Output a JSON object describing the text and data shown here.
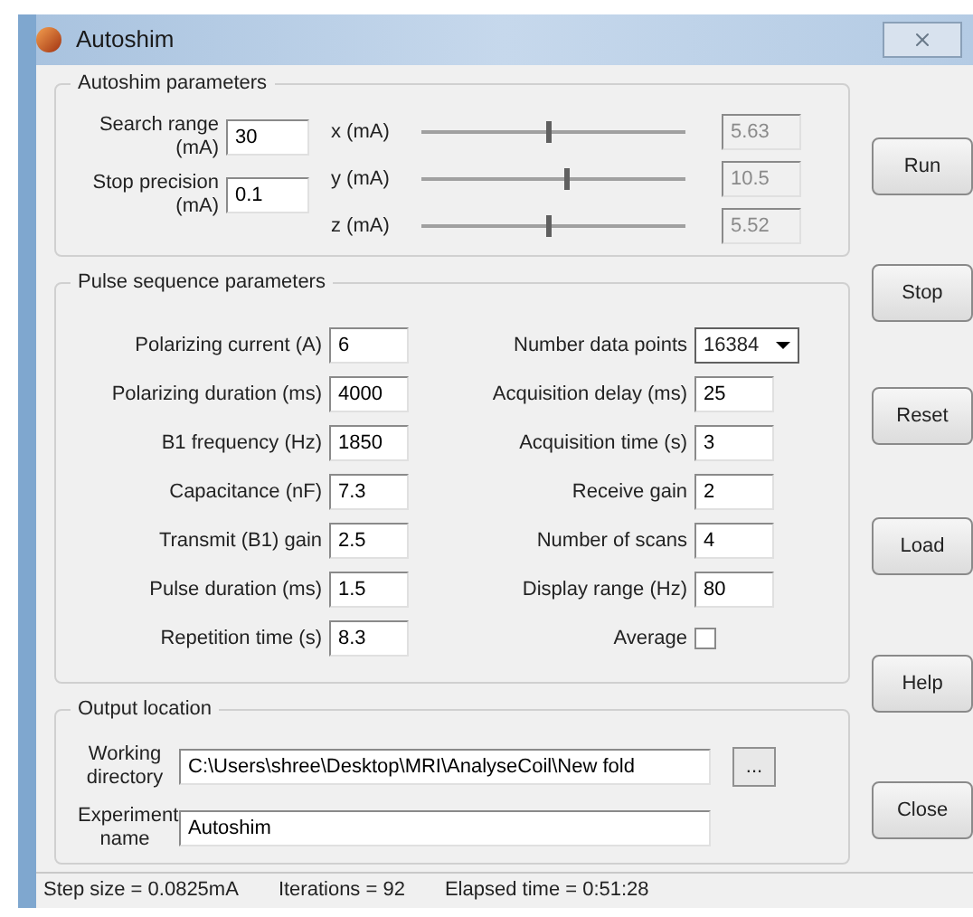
{
  "window": {
    "title": "Autoshim"
  },
  "autoshim": {
    "title": "Autoshim parameters",
    "fields": [
      {
        "label": "Search range (mA)",
        "value": "30"
      },
      {
        "label": "Stop precision (mA)",
        "value": "0.1"
      }
    ],
    "sliders": [
      {
        "label": "x (mA)",
        "level": 0.48,
        "reading": "5.63"
      },
      {
        "label": "y (mA)",
        "level": 0.55,
        "reading": "10.5"
      },
      {
        "label": "z (mA)",
        "level": 0.48,
        "reading": "5.52"
      }
    ]
  },
  "pulse": {
    "title": "Pulse sequence parameters",
    "left": [
      {
        "label": "Polarizing current (A)",
        "value": "6"
      },
      {
        "label": "Polarizing duration (ms)",
        "value": "4000"
      },
      {
        "label": "B1 frequency (Hz)",
        "value": "1850"
      },
      {
        "label": "Capacitance (nF)",
        "value": "7.3"
      },
      {
        "label": "Transmit (B1) gain",
        "value": "2.5"
      },
      {
        "label": "Pulse duration (ms)",
        "value": "1.5"
      },
      {
        "label": "Repetition time (s)",
        "value": "8.3"
      }
    ],
    "right": [
      {
        "kind": "dropdown",
        "label": "Number data points",
        "value": "16384"
      },
      {
        "kind": "text",
        "label": "Acquisition delay (ms)",
        "value": "25"
      },
      {
        "kind": "text",
        "label": "Acquisition time (s)",
        "value": "3"
      },
      {
        "kind": "text",
        "label": "Receive gain",
        "value": "2"
      },
      {
        "kind": "text",
        "label": "Number of scans",
        "value": "4"
      },
      {
        "kind": "text",
        "label": "Display range (Hz)",
        "value": "80"
      },
      {
        "kind": "checkbox",
        "label": "Average",
        "checked": false
      }
    ]
  },
  "output": {
    "title": "Output location",
    "directory": {
      "label": "Working directory",
      "value": "C:\\Users\\shree\\Desktop\\MRI\\AnalyseCoil\\New fold",
      "browse": "..."
    },
    "experiment": {
      "label": "Experiment name",
      "value": "Autoshim"
    }
  },
  "buttons": [
    "Run",
    "Stop",
    "Reset",
    "Load",
    "Help",
    "Close"
  ],
  "status_bar": [
    "Step size = 0.0825mA",
    "Iterations = 92",
    "Elapsed time = 0:51:28"
  ]
}
